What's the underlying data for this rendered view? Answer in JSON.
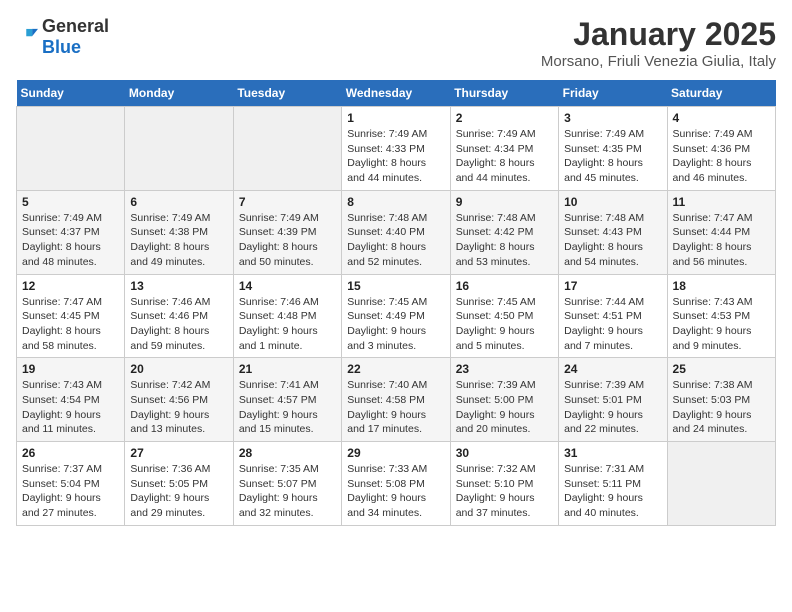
{
  "header": {
    "logo_general": "General",
    "logo_blue": "Blue",
    "title": "January 2025",
    "subtitle": "Morsano, Friuli Venezia Giulia, Italy"
  },
  "weekdays": [
    "Sunday",
    "Monday",
    "Tuesday",
    "Wednesday",
    "Thursday",
    "Friday",
    "Saturday"
  ],
  "weeks": [
    [
      {
        "day": "",
        "info": ""
      },
      {
        "day": "",
        "info": ""
      },
      {
        "day": "",
        "info": ""
      },
      {
        "day": "1",
        "info": "Sunrise: 7:49 AM\nSunset: 4:33 PM\nDaylight: 8 hours\nand 44 minutes."
      },
      {
        "day": "2",
        "info": "Sunrise: 7:49 AM\nSunset: 4:34 PM\nDaylight: 8 hours\nand 44 minutes."
      },
      {
        "day": "3",
        "info": "Sunrise: 7:49 AM\nSunset: 4:35 PM\nDaylight: 8 hours\nand 45 minutes."
      },
      {
        "day": "4",
        "info": "Sunrise: 7:49 AM\nSunset: 4:36 PM\nDaylight: 8 hours\nand 46 minutes."
      }
    ],
    [
      {
        "day": "5",
        "info": "Sunrise: 7:49 AM\nSunset: 4:37 PM\nDaylight: 8 hours\nand 48 minutes."
      },
      {
        "day": "6",
        "info": "Sunrise: 7:49 AM\nSunset: 4:38 PM\nDaylight: 8 hours\nand 49 minutes."
      },
      {
        "day": "7",
        "info": "Sunrise: 7:49 AM\nSunset: 4:39 PM\nDaylight: 8 hours\nand 50 minutes."
      },
      {
        "day": "8",
        "info": "Sunrise: 7:48 AM\nSunset: 4:40 PM\nDaylight: 8 hours\nand 52 minutes."
      },
      {
        "day": "9",
        "info": "Sunrise: 7:48 AM\nSunset: 4:42 PM\nDaylight: 8 hours\nand 53 minutes."
      },
      {
        "day": "10",
        "info": "Sunrise: 7:48 AM\nSunset: 4:43 PM\nDaylight: 8 hours\nand 54 minutes."
      },
      {
        "day": "11",
        "info": "Sunrise: 7:47 AM\nSunset: 4:44 PM\nDaylight: 8 hours\nand 56 minutes."
      }
    ],
    [
      {
        "day": "12",
        "info": "Sunrise: 7:47 AM\nSunset: 4:45 PM\nDaylight: 8 hours\nand 58 minutes."
      },
      {
        "day": "13",
        "info": "Sunrise: 7:46 AM\nSunset: 4:46 PM\nDaylight: 8 hours\nand 59 minutes."
      },
      {
        "day": "14",
        "info": "Sunrise: 7:46 AM\nSunset: 4:48 PM\nDaylight: 9 hours\nand 1 minute."
      },
      {
        "day": "15",
        "info": "Sunrise: 7:45 AM\nSunset: 4:49 PM\nDaylight: 9 hours\nand 3 minutes."
      },
      {
        "day": "16",
        "info": "Sunrise: 7:45 AM\nSunset: 4:50 PM\nDaylight: 9 hours\nand 5 minutes."
      },
      {
        "day": "17",
        "info": "Sunrise: 7:44 AM\nSunset: 4:51 PM\nDaylight: 9 hours\nand 7 minutes."
      },
      {
        "day": "18",
        "info": "Sunrise: 7:43 AM\nSunset: 4:53 PM\nDaylight: 9 hours\nand 9 minutes."
      }
    ],
    [
      {
        "day": "19",
        "info": "Sunrise: 7:43 AM\nSunset: 4:54 PM\nDaylight: 9 hours\nand 11 minutes."
      },
      {
        "day": "20",
        "info": "Sunrise: 7:42 AM\nSunset: 4:56 PM\nDaylight: 9 hours\nand 13 minutes."
      },
      {
        "day": "21",
        "info": "Sunrise: 7:41 AM\nSunset: 4:57 PM\nDaylight: 9 hours\nand 15 minutes."
      },
      {
        "day": "22",
        "info": "Sunrise: 7:40 AM\nSunset: 4:58 PM\nDaylight: 9 hours\nand 17 minutes."
      },
      {
        "day": "23",
        "info": "Sunrise: 7:39 AM\nSunset: 5:00 PM\nDaylight: 9 hours\nand 20 minutes."
      },
      {
        "day": "24",
        "info": "Sunrise: 7:39 AM\nSunset: 5:01 PM\nDaylight: 9 hours\nand 22 minutes."
      },
      {
        "day": "25",
        "info": "Sunrise: 7:38 AM\nSunset: 5:03 PM\nDaylight: 9 hours\nand 24 minutes."
      }
    ],
    [
      {
        "day": "26",
        "info": "Sunrise: 7:37 AM\nSunset: 5:04 PM\nDaylight: 9 hours\nand 27 minutes."
      },
      {
        "day": "27",
        "info": "Sunrise: 7:36 AM\nSunset: 5:05 PM\nDaylight: 9 hours\nand 29 minutes."
      },
      {
        "day": "28",
        "info": "Sunrise: 7:35 AM\nSunset: 5:07 PM\nDaylight: 9 hours\nand 32 minutes."
      },
      {
        "day": "29",
        "info": "Sunrise: 7:33 AM\nSunset: 5:08 PM\nDaylight: 9 hours\nand 34 minutes."
      },
      {
        "day": "30",
        "info": "Sunrise: 7:32 AM\nSunset: 5:10 PM\nDaylight: 9 hours\nand 37 minutes."
      },
      {
        "day": "31",
        "info": "Sunrise: 7:31 AM\nSunset: 5:11 PM\nDaylight: 9 hours\nand 40 minutes."
      },
      {
        "day": "",
        "info": ""
      }
    ]
  ]
}
